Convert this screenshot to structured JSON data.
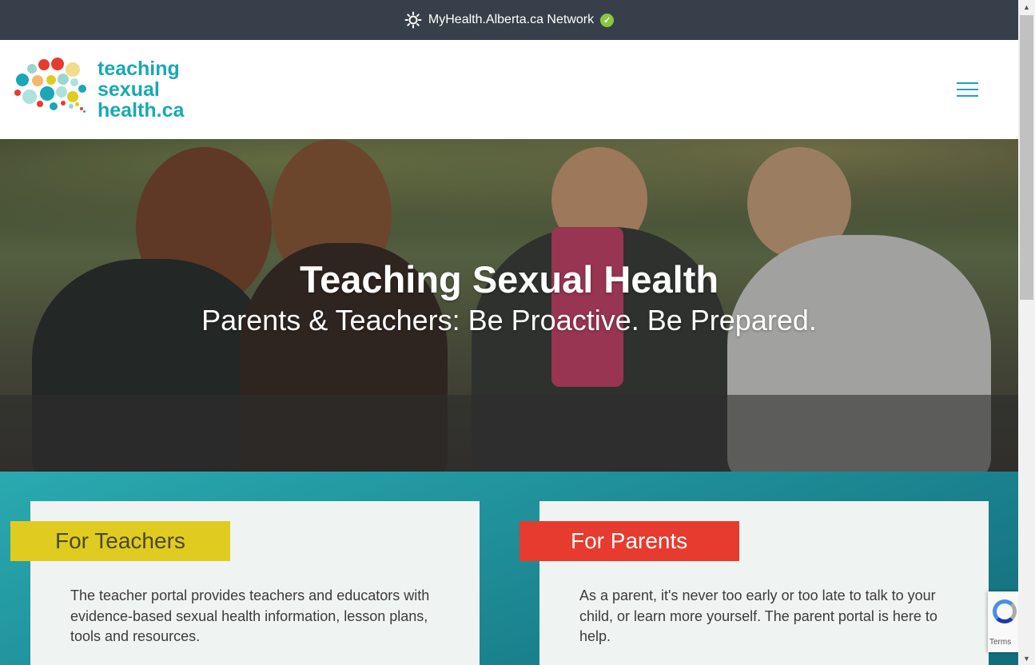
{
  "topbar": {
    "network_label": "MyHealth.Alberta.ca Network"
  },
  "logo": {
    "line1": "teaching",
    "line2": "sexual",
    "line3": "health.ca"
  },
  "hero": {
    "title": "Teaching Sexual Health",
    "subtitle": "Parents & Teachers: Be Proactive. Be Prepared."
  },
  "cards": [
    {
      "label": "For Teachers",
      "text": "The teacher portal provides teachers and educators with evidence-based sexual health information, lesson plans, tools and resources."
    },
    {
      "label": "For Parents",
      "text": "As a parent, it's never too early or too late to talk to your child, or learn more yourself. The parent portal is here to help."
    }
  ],
  "recaptcha": {
    "terms": "Terms"
  },
  "colors": {
    "topbar": "#37404a",
    "brand_teal": "#19a8b5",
    "teachers_yellow": "#e0cb20",
    "parents_red": "#e63b2e",
    "check_green": "#8cc63f"
  },
  "icons": {
    "network": "sun-icon",
    "verified": "check-circle-icon",
    "menu": "hamburger-icon"
  }
}
